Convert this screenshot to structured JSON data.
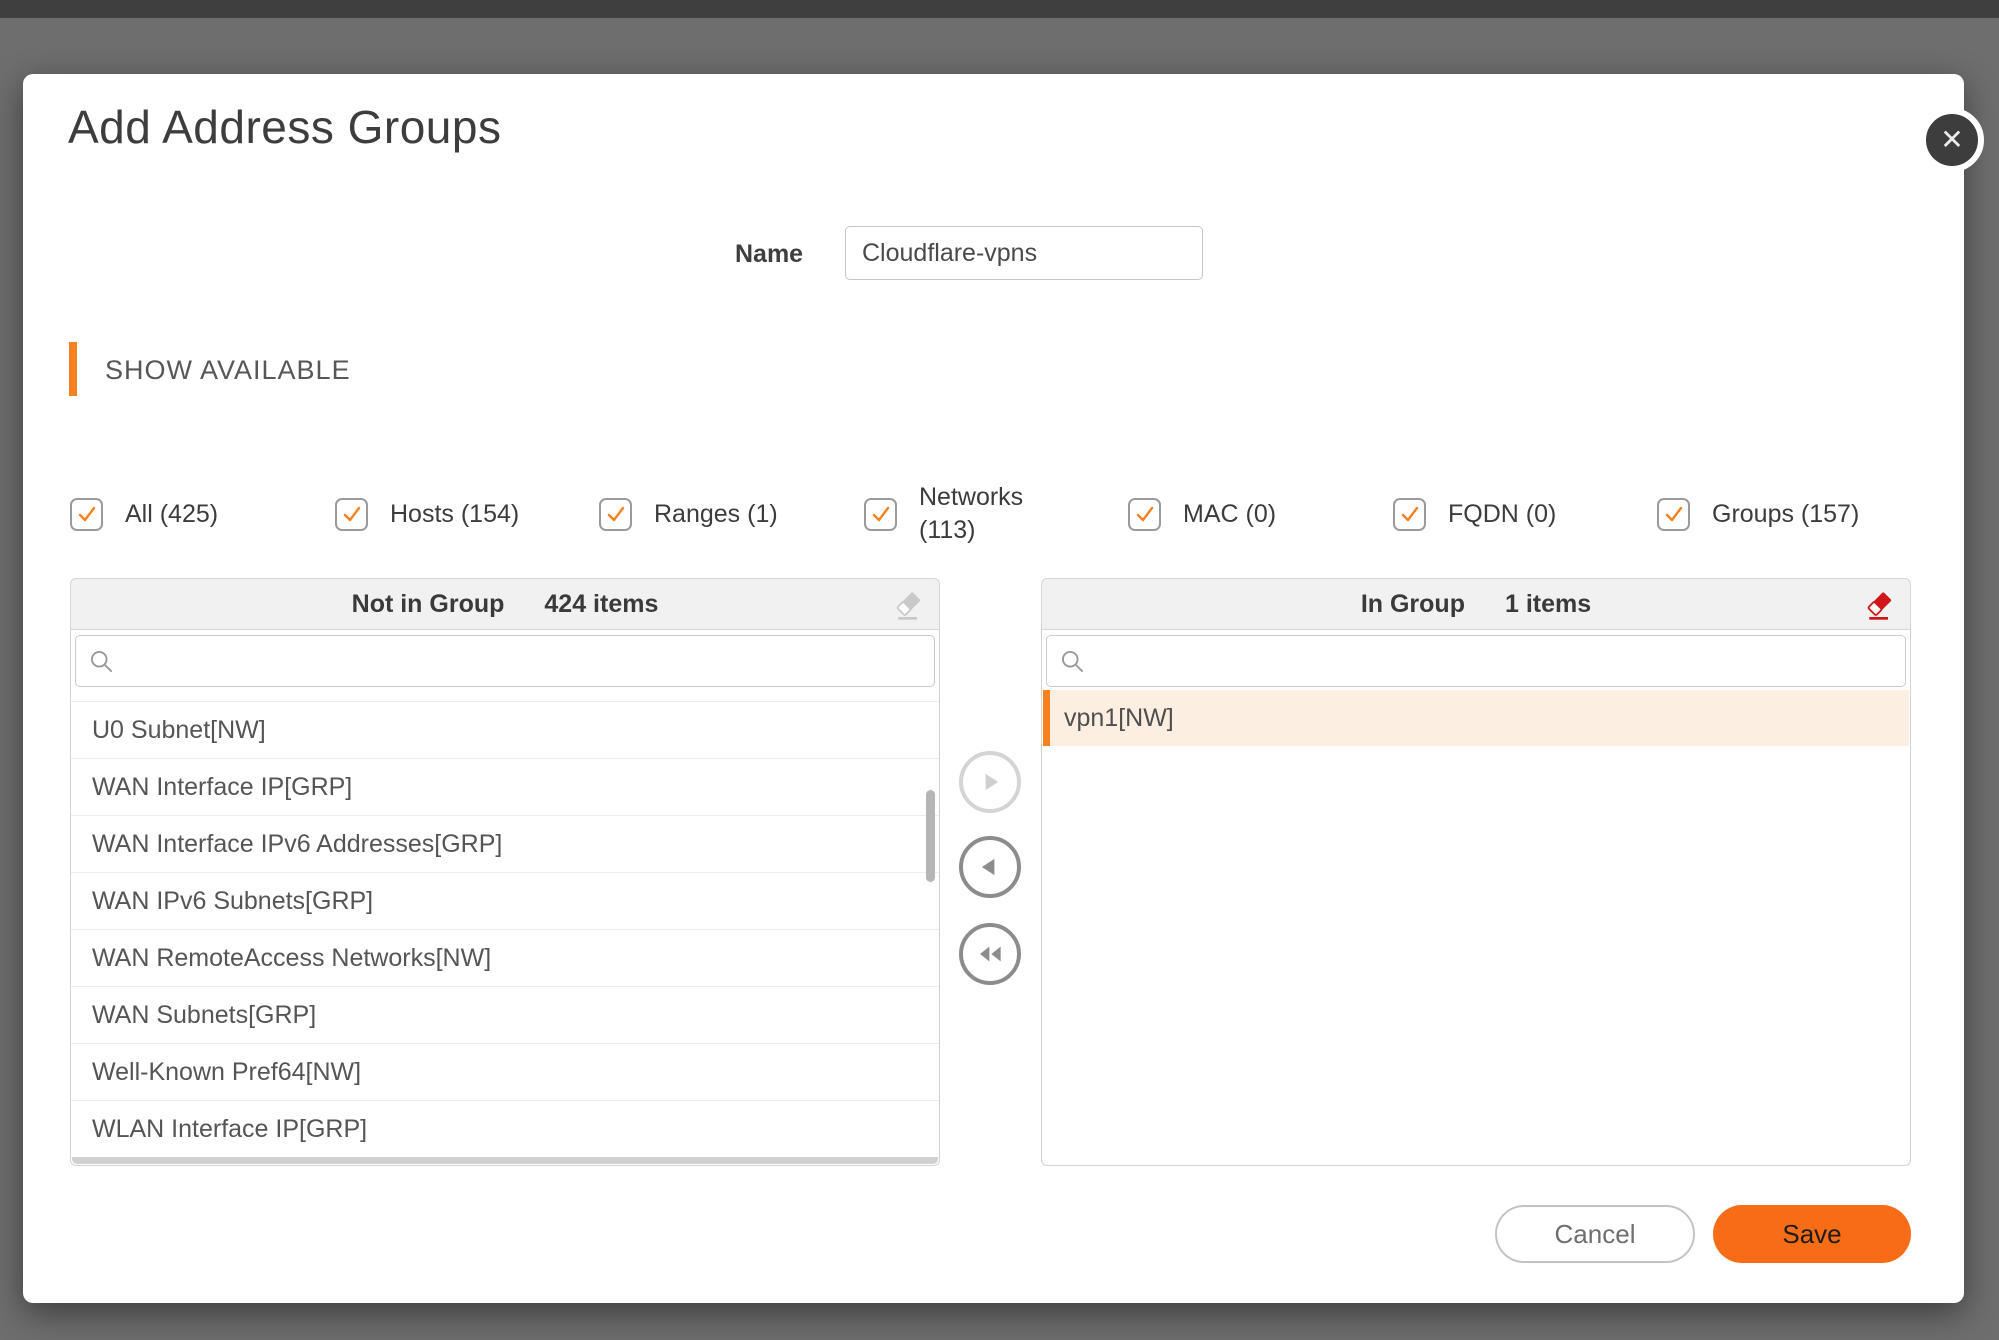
{
  "dialog": {
    "title": "Add Address Groups",
    "close_icon": "✕",
    "name_field": {
      "label": "Name",
      "value": "Cloudflare-vpns"
    },
    "section_title": "SHOW AVAILABLE",
    "filters": [
      {
        "label": "All (425)",
        "checked": true
      },
      {
        "label": "Hosts (154)",
        "checked": true
      },
      {
        "label": "Ranges (1)",
        "checked": true
      },
      {
        "label": "Networks (113)",
        "checked": true,
        "lines": [
          "Networks",
          "(113)"
        ]
      },
      {
        "label": "MAC (0)",
        "checked": true
      },
      {
        "label": "FQDN (0)",
        "checked": true
      },
      {
        "label": "Groups (157)",
        "checked": true
      }
    ],
    "not_in_group": {
      "title": "Not in Group",
      "count": "424 items",
      "search_value": "",
      "items": [
        "U0 Subnet[NW]",
        "WAN Interface IP[GRP]",
        "WAN Interface IPv6 Addresses[GRP]",
        "WAN IPv6 Subnets[GRP]",
        "WAN RemoteAccess Networks[NW]",
        "WAN Subnets[GRP]",
        "Well-Known Pref64[NW]",
        "WLAN Interface IP[GRP]"
      ]
    },
    "in_group": {
      "title": "In Group",
      "count": "1 items",
      "search_value": "",
      "items": [
        "vpn1[NW]"
      ],
      "selected_item": "vpn1[NW]"
    },
    "footer": {
      "cancel": "Cancel",
      "save": "Save"
    },
    "colors": {
      "accent_orange": "#f6821f",
      "save_orange": "#f76d17",
      "eraser_red": "#d0161b",
      "eraser_gray": "#c9c9c9",
      "arrow_disabled": "#cfcfcf",
      "arrow_enabled": "#8c8c8c"
    }
  }
}
